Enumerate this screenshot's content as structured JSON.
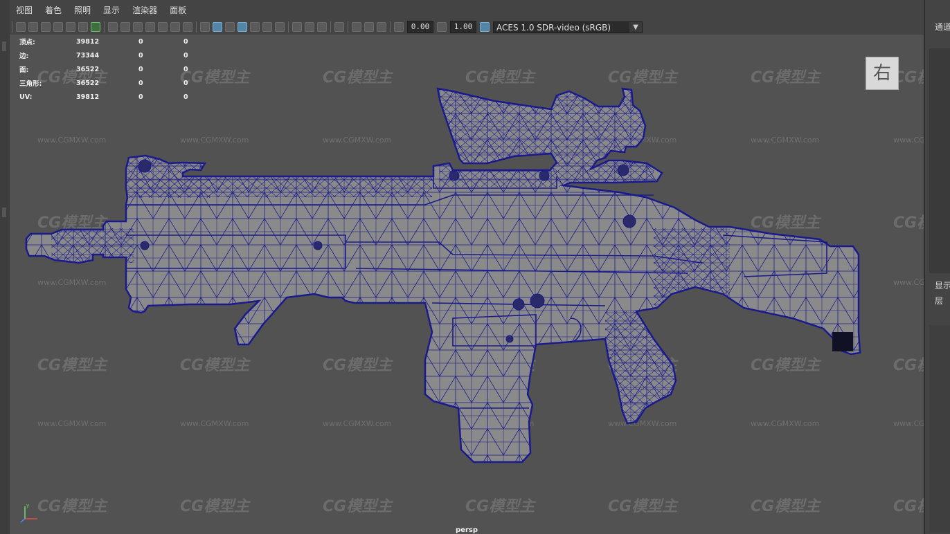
{
  "menu": [
    "视图",
    "着色",
    "照明",
    "显示",
    "渲染器",
    "面板"
  ],
  "toolbar": {
    "exposure": "0.00",
    "gamma": "1.00",
    "color_space": "ACES 1.0 SDR-video (sRGB)"
  },
  "hud": {
    "rows": [
      {
        "label": "顶点:",
        "v1": "39812",
        "v2": "0",
        "v3": "0"
      },
      {
        "label": "边:",
        "v1": "73344",
        "v2": "0",
        "v3": "0"
      },
      {
        "label": "面:",
        "v1": "36522",
        "v2": "0",
        "v3": "0"
      },
      {
        "label": "三角形:",
        "v1": "36522",
        "v2": "0",
        "v3": "0"
      },
      {
        "label": "UV:",
        "v1": "39812",
        "v2": "0",
        "v3": "0"
      }
    ]
  },
  "view_cube_label": "右",
  "camera": "persp",
  "axis": {
    "y": "y",
    "x": "x",
    "z": "z"
  },
  "watermark": {
    "logo": "CG模型主",
    "url": "www.CGMXW.com"
  },
  "right_panel": {
    "tab1": "通道",
    "tab2": "显示",
    "tab3": "层"
  },
  "colors": {
    "wireframe": "#1a1a8c",
    "mesh_fill": "#8a8a8a",
    "viewport_bg": "#525252"
  }
}
